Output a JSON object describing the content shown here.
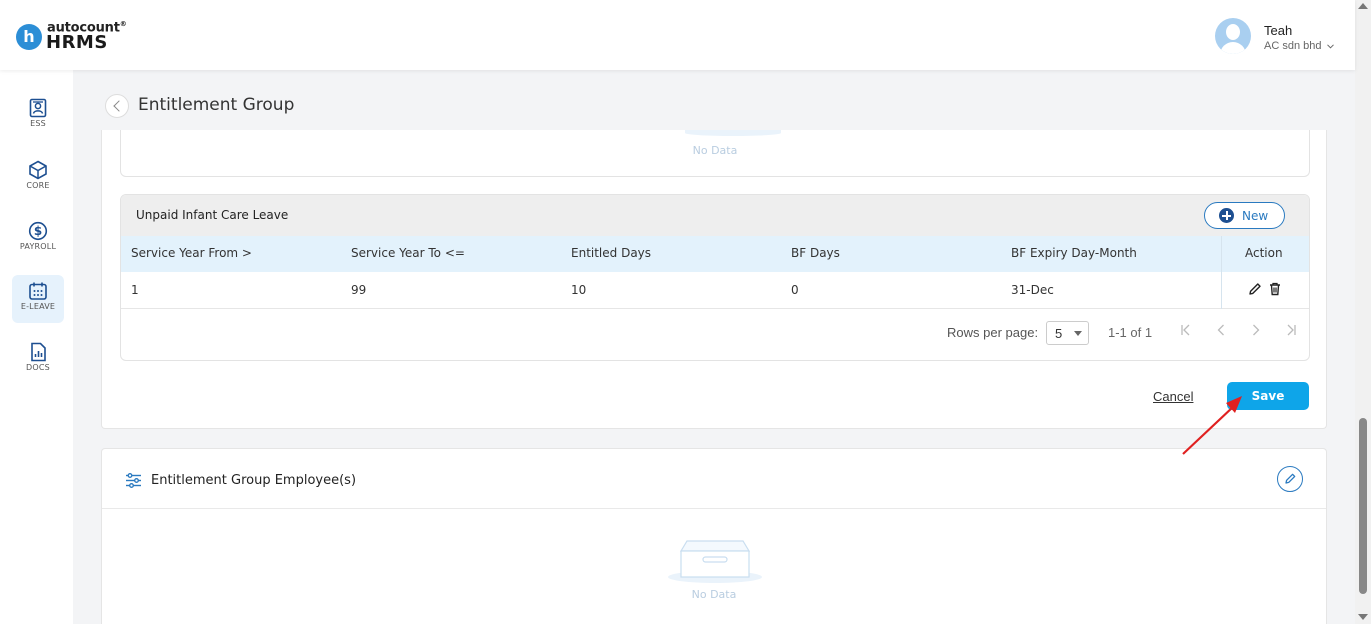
{
  "brand": {
    "logo_letter": "h",
    "logo_top": "autocount",
    "logo_trademark": "®",
    "logo_main": "HRMS"
  },
  "user": {
    "name": "Teah",
    "company": "AC sdn bhd"
  },
  "sidebar": {
    "items": [
      {
        "label": "ESS",
        "icon": "ess-icon"
      },
      {
        "label": "CORE",
        "icon": "core-icon"
      },
      {
        "label": "PAYROLL",
        "icon": "payroll-icon"
      },
      {
        "label": "E-LEAVE",
        "icon": "e-leave-icon",
        "active": true
      },
      {
        "label": "DOCS",
        "icon": "docs-icon"
      }
    ]
  },
  "page": {
    "title": "Entitlement Group"
  },
  "previous_section": {
    "empty_text": "No Data"
  },
  "leave_table": {
    "title": "Unpaid Infant Care Leave",
    "new_label": "New",
    "columns": [
      "Service Year From >",
      "Service Year To <=",
      "Entitled Days",
      "BF Days",
      "BF Expiry Day-Month",
      "Action"
    ],
    "rows": [
      [
        "1",
        "99",
        "10",
        "0",
        "31-Dec"
      ]
    ],
    "pagination": {
      "rows_per_page_label": "Rows per page:",
      "rows_per_page_value": "5",
      "range_text": "1-1 of 1"
    }
  },
  "form_actions": {
    "cancel_label": "Cancel",
    "save_label": "Save"
  },
  "employees_section": {
    "title": "Entitlement Group Employee(s)",
    "empty_text": "No Data"
  },
  "colors": {
    "primary": "#0ea5e9",
    "brand_blue": "#2c8ed6",
    "table_header_bg": "#e3f2fc",
    "annotation_arrow": "#e02020"
  }
}
